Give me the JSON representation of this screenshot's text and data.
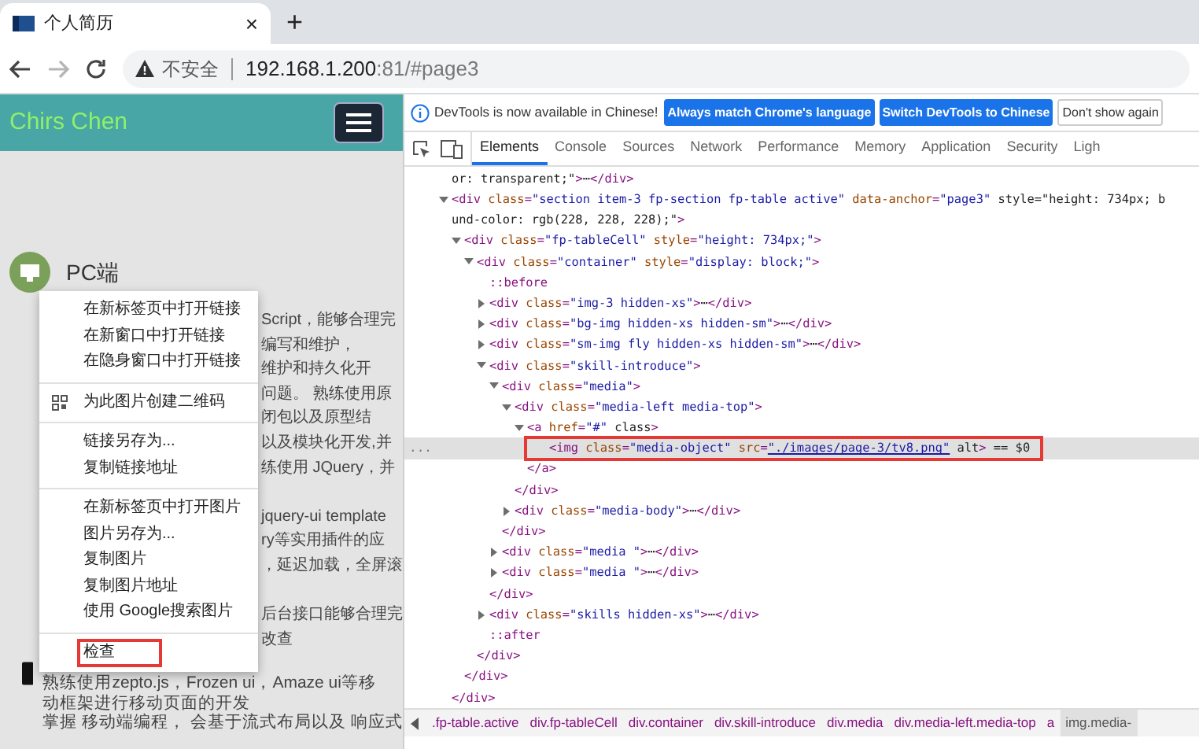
{
  "browser_tab": {
    "title": "个人简历",
    "close": "×",
    "new_tab": "+"
  },
  "address_bar": {
    "security": "不安全",
    "url_host": "192.168.1.200",
    "url_rest": ":81/#page3",
    "forward_disabled": true
  },
  "page": {
    "brand": "Chirs Chen",
    "heading": "PC端",
    "body_paragraphs": [
      [
        "Script，能够合理完",
        "编写和维护，",
        "维护和持久化开",
        "问题。 熟练使用原",
        "闭包以及原型结",
        "以及模块化开发,并",
        "练使用 JQuery，并"
      ],
      [
        "jquery-ui template",
        "ry等实用插件的应",
        "，延迟加载，全屏滚"
      ],
      [
        "后台接口能够合理完",
        "改查"
      ]
    ],
    "bottom_lines": [
      "熟练使用zepto.js，Frozen ui，Amaze ui等移",
      "动框架进行移动页面的开发",
      "掌握 移动端编程， 会基于流式布局以及 响应式"
    ]
  },
  "context_menu": [
    {
      "kind": "item",
      "label": "在新标签页中打开链接",
      "highlighted": false
    },
    {
      "kind": "item",
      "label": "在新窗口中打开链接",
      "highlighted": false
    },
    {
      "kind": "item",
      "label": "在隐身窗口中打开链接",
      "highlighted": false
    },
    {
      "kind": "separator"
    },
    {
      "kind": "qr",
      "label": "为此图片创建二维码",
      "highlighted": false
    },
    {
      "kind": "separator"
    },
    {
      "kind": "item",
      "label": "链接另存为...",
      "highlighted": false
    },
    {
      "kind": "item",
      "label": "复制链接地址",
      "highlighted": false
    },
    {
      "kind": "separator"
    },
    {
      "kind": "item",
      "label": "在新标签页中打开图片",
      "highlighted": false
    },
    {
      "kind": "item",
      "label": "图片另存为...",
      "highlighted": false
    },
    {
      "kind": "item",
      "label": "复制图片",
      "highlighted": false
    },
    {
      "kind": "item",
      "label": "复制图片地址",
      "highlighted": false
    },
    {
      "kind": "item",
      "label": "使用 Google搜索图片",
      "highlighted": false
    },
    {
      "kind": "separator"
    },
    {
      "kind": "item",
      "label": "检查",
      "highlighted": true
    }
  ],
  "devtools": {
    "infobar": {
      "message": "DevTools is now available in Chinese!",
      "buttons": [
        {
          "label": "Always match Chrome's language",
          "primary": true
        },
        {
          "label": "Switch DevTools to Chinese",
          "primary": true
        },
        {
          "label": "Don't show again",
          "primary": false
        }
      ]
    },
    "tabs": [
      {
        "label": "Elements",
        "selected": true
      },
      {
        "label": "Console",
        "selected": false
      },
      {
        "label": "Sources",
        "selected": false
      },
      {
        "label": "Network",
        "selected": false
      },
      {
        "label": "Performance",
        "selected": false
      },
      {
        "label": "Memory",
        "selected": false
      },
      {
        "label": "Application",
        "selected": false
      },
      {
        "label": "Security",
        "selected": false
      },
      {
        "label": "Ligh",
        "selected": false
      }
    ],
    "dom_tree": [
      {
        "text": "or: transparent;\">⋯</div>"
      },
      {
        "text": "<div class=\"section item-3 fp-section fp-table active\" data-anchor=\"page3\" style=\"height: 734px; b",
        "continuation": "und-color: rgb(228, 228, 228);\">",
        "expanded": true,
        "end": "</div>",
        "children": [
          {
            "text": "<div class=\"fp-tableCell\" style=\"height: 734px;\">",
            "expanded": true,
            "end": "</div>",
            "children": [
              {
                "text": "<div class=\"container\" style=\"display: block;\">",
                "expanded": true,
                "end": "</div>",
                "children": [
                  {
                    "text": "::before",
                    "pseudo": true
                  },
                  {
                    "text": "<div class=\"img-3 hidden-xs\">⋯</div>",
                    "expanded": false
                  },
                  {
                    "text": "<div class=\"bg-img hidden-xs hidden-sm\">⋯</div>",
                    "expanded": false
                  },
                  {
                    "text": "<div class=\"sm-img fly hidden-xs hidden-sm\">⋯</div>",
                    "expanded": false
                  },
                  {
                    "text": "<div class=\"skill-introduce\">",
                    "expanded": true,
                    "end": "</div>",
                    "children": [
                      {
                        "text": "<div class=\"media\">",
                        "expanded": true,
                        "end": "</div>",
                        "children": [
                          {
                            "text": "<div class=\"media-left media-top\">",
                            "expanded": true,
                            "end": "</div>",
                            "children": [
                              {
                                "text": "<a href=\"#\" class>",
                                "expanded": true,
                                "end": "</a>",
                                "children": [
                                  {
                                    "text": "<img class=\"media-object\" src=\"./images/page-3/tv8.png\" alt> == $0",
                                    "selected": true,
                                    "highlighted": true,
                                    "gutter": "..."
                                  }
                                ]
                              }
                            ]
                          },
                          {
                            "text": "<div class=\"media-body\">⋯</div>",
                            "expanded": false
                          }
                        ]
                      },
                      {
                        "text": "<div class=\"media \">⋯</div>",
                        "expanded": false
                      },
                      {
                        "text": "<div class=\"media \">⋯</div>",
                        "expanded": false
                      }
                    ]
                  },
                  {
                    "text": "<div class=\"skills hidden-xs\">⋯</div>",
                    "expanded": false
                  },
                  {
                    "text": "::after",
                    "pseudo": true
                  }
                ]
              }
            ]
          }
        ]
      }
    ],
    "breadcrumbs": [
      {
        "label": ".fp-table.active",
        "selected": false
      },
      {
        "label": "div.fp-tableCell",
        "selected": false
      },
      {
        "label": "div.container",
        "selected": false
      },
      {
        "label": "div.skill-introduce",
        "selected": false
      },
      {
        "label": "div.media",
        "selected": false
      },
      {
        "label": "div.media-left.media-top",
        "selected": false
      },
      {
        "label": "a",
        "selected": false
      },
      {
        "label": "img.media-",
        "selected": true
      }
    ]
  }
}
